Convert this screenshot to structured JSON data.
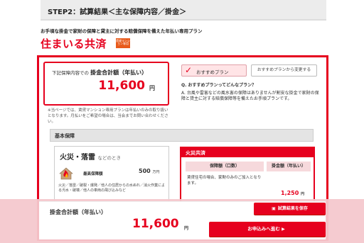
{
  "header": {
    "step_title": "STEP2：試算結果＜主な保障内容／掛金＞"
  },
  "intro": {
    "text": "お手頃な掛金で家財の保障と貸主に対する賠償保障を備えた年払い専用プラン"
  },
  "brand": {
    "name": "住まいる共済",
    "badge": "賃貸マンション専用"
  },
  "summary": {
    "label_prefix": "下記保障内容での",
    "label_main": "掛金合計額（年払い）",
    "amount": "11,600",
    "unit": "円",
    "note": "※当ページでは、賃貸マンション専用プランは年払いのみの取り扱いとなります。月払いをご希望の場合は、当会までお問い合わせください。"
  },
  "plan": {
    "recommended_label": "おすすめプラン",
    "change_label": "おすすめプランから変更する",
    "question": "Q. おすすめプランってどんなプラン？",
    "answer": "A. 台風や雷害などの風水害の保障はありませんが割安な掛金で家財の保障と貸主に対する賠償保障等を備えたお手頃プランです。"
  },
  "basic": {
    "section_title": "基本保障",
    "fire_title": "火災・落雷",
    "fire_sub": "などのとき",
    "limit_label": "最高保障額",
    "limit_value": "500",
    "limit_unit": "万円",
    "fire_desc": "火災／落雷／破裂・爆発／他人の住居からの水ぬれ／消火作業による汚水・破壊／他人の車両の飛び込みなど"
  },
  "kyosai": {
    "title": "火災共済",
    "col_coverage": "保障額（口数）",
    "col_premium": "掛金額（年払い）",
    "row_desc": "賃貸住宅の場合、家財のみのご加入となります。",
    "row_value": "1,250",
    "row_unit": "円"
  },
  "footer": {
    "total_label": "掛金合計額（年払い）",
    "total_amount": "11,600",
    "total_unit": "円",
    "save_label": "試算結果を保存",
    "apply_label": "お申込みへ進む"
  },
  "colors": {
    "accent": "#e6001e",
    "highlight_overlay": "#f4c8ce"
  }
}
